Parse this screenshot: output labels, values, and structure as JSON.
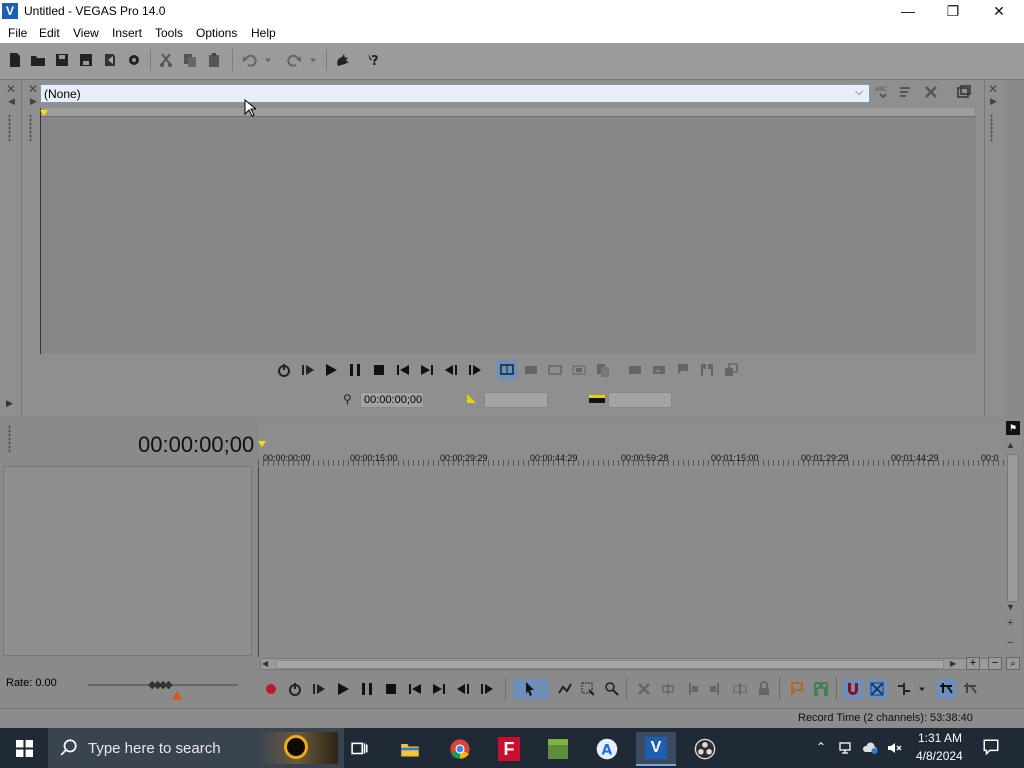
{
  "window": {
    "title": "Untitled - VEGAS Pro 14.0",
    "app_icon_letter": "V",
    "minimize": "—",
    "maximize": "❐",
    "close": "✕"
  },
  "menu": [
    "File",
    "Edit",
    "View",
    "Insert",
    "Tools",
    "Options",
    "Help"
  ],
  "preview": {
    "preset_value": "(None)",
    "cursor_timecode": "00:00:00;00"
  },
  "timeline": {
    "current_time": "00:00:00;00",
    "ruler_labels": [
      "00:00:00:00",
      "00:00:15:00",
      "00:00:29:29",
      "00:00:44:29",
      "00:00:59:28",
      "00:01:15:00",
      "00:01:29:29",
      "00:01:44:29",
      "00:0"
    ],
    "rate_label": "Rate: 0.00"
  },
  "status": {
    "record_time": "Record Time (2 channels): 53:38:40"
  },
  "taskbar": {
    "search_placeholder": "Type here to search",
    "time": "1:31 AM",
    "date": "4/8/2024"
  },
  "colors": {
    "accent_blue": "#1d5fb3",
    "panel_gray": "#8a8a8a",
    "taskbar": "#1f2a36"
  }
}
